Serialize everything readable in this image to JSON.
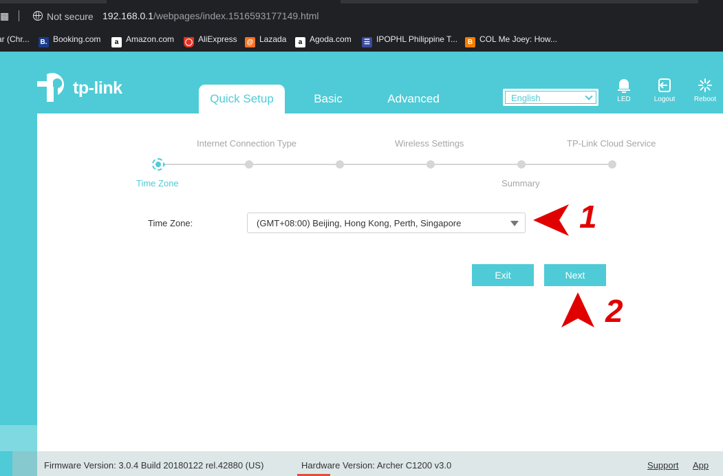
{
  "browser": {
    "security_label": "Not secure",
    "url_host": "192.168.0.1",
    "url_path": "/webpages/index.1516593177149.html",
    "bookmarks": [
      {
        "label": "ar (Chr...",
        "icon": "bookmark-icon"
      },
      {
        "label": "Booking.com",
        "icon": "booking-icon"
      },
      {
        "label": "Amazon.com",
        "icon": "amazon-icon"
      },
      {
        "label": "AliExpress",
        "icon": "aliexpress-icon"
      },
      {
        "label": "Lazada",
        "icon": "lazada-icon"
      },
      {
        "label": "Agoda.com",
        "icon": "agoda-icon"
      },
      {
        "label": "IPOPHL Philippine T...",
        "icon": "ipophl-icon"
      },
      {
        "label": "COL Me Joey: How...",
        "icon": "blogger-icon"
      }
    ]
  },
  "router": {
    "brand": "tp-link",
    "tabs": [
      "Quick Setup",
      "Basic",
      "Advanced"
    ],
    "active_tab": "Quick Setup",
    "language": "English",
    "tools": [
      {
        "label": "LED",
        "icon": "led-bulb-icon"
      },
      {
        "label": "Logout",
        "icon": "logout-icon"
      },
      {
        "label": "Reboot",
        "icon": "reboot-icon"
      }
    ],
    "colors": {
      "accent": "#4ecbd6",
      "annotation": "#e00000"
    }
  },
  "wizard": {
    "steps_top": [
      "Internet Connection Type",
      "Wireless Settings",
      "TP-Link Cloud Service"
    ],
    "steps_bottom": [
      "Time Zone",
      "Summary"
    ],
    "current_step": "Time Zone",
    "time_zone_label": "Time Zone:",
    "time_zone_value": "(GMT+08:00) Beijing, Hong Kong, Perth, Singapore",
    "exit_label": "Exit",
    "next_label": "Next"
  },
  "annotations": {
    "first": "1",
    "second": "2"
  },
  "footer": {
    "firmware": "Firmware Version: 3.0.4 Build 20180122 rel.42880 (US)",
    "hardware": "Hardware Version: Archer C1200 v3.0",
    "support": "Support",
    "app": "App"
  }
}
